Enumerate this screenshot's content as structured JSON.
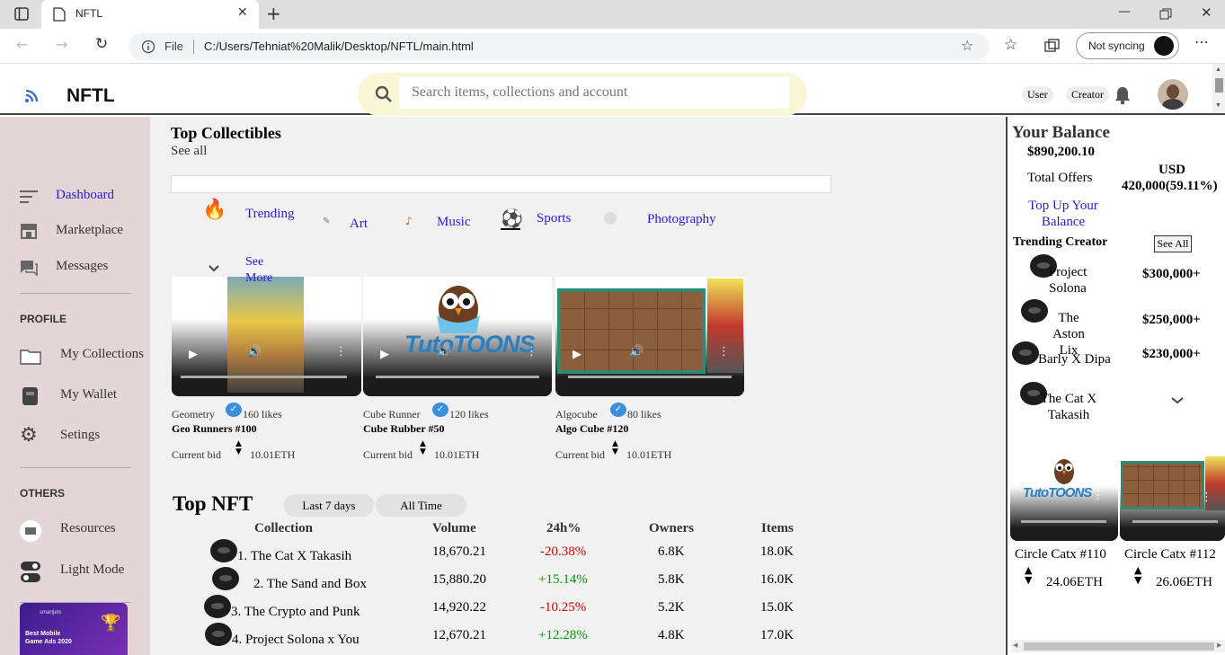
{
  "browser": {
    "tab_title": "NFTL",
    "file_label": "File",
    "url": "C:/Users/Tehniat%20Malik/Desktop/NFTL/main.html",
    "sync_label": "Not syncing"
  },
  "header": {
    "brand": "NFTL",
    "search_placeholder": "Search items, collections and account",
    "user_label": "User",
    "creator_label": "Creator"
  },
  "sidebar": {
    "nav": [
      {
        "label": "Dashboard",
        "icon": "menu-lines-icon",
        "active": true
      },
      {
        "label": "Marketplace",
        "icon": "store-icon"
      },
      {
        "label": "Messages",
        "icon": "chat-icon"
      }
    ],
    "profile_heading": "PROFILE",
    "profile": [
      {
        "label": "My Collections",
        "icon": "folder-icon"
      },
      {
        "label": "My Wallet",
        "icon": "wallet-icon"
      },
      {
        "label": "Setings",
        "icon": "gear-icon"
      }
    ],
    "others_heading": "OTHERS",
    "others": [
      {
        "label": "Resources",
        "icon": "book-icon"
      },
      {
        "label": "Light Mode",
        "icon": "toggle-icon"
      }
    ],
    "ad": {
      "brand": "smartjets",
      "text": "Best Mobile Game Ads 2020"
    }
  },
  "top_collectibles": {
    "title": "Top Collectibles",
    "see_all": "See all",
    "categories": [
      "Trending",
      "Art",
      "Music",
      "Sports",
      "Photography"
    ],
    "see_more": "See More",
    "cards": [
      {
        "creator": "Geometry",
        "likes": "160 likes",
        "name": "Geo Runners #100",
        "bid_label": "Current bid",
        "bid": "10.01ETH"
      },
      {
        "creator": "Cube Runner",
        "likes": "120 likes",
        "name": "Cube Rubber #50",
        "bid_label": "Current bid",
        "bid": "10.01ETH",
        "video_text": "TutoTOONS"
      },
      {
        "creator": "Algocube",
        "likes": "80 likes",
        "name": "Algo Cube #120",
        "bid_label": "Current bid",
        "bid": "10.01ETH"
      }
    ]
  },
  "top_nft": {
    "title": "Top NFT",
    "filters": [
      "Last 7 days",
      "All Time"
    ],
    "columns": [
      "Collection",
      "Volume",
      "24h%",
      "Owners",
      "Items"
    ],
    "rows": [
      {
        "collection": "1. The Cat X Takasih",
        "volume": "18,670.21",
        "change": "-20.38%",
        "owners": "6.8K",
        "items": "18.0K",
        "trend": "down"
      },
      {
        "collection": "2. The Sand and Box",
        "volume": "15,880.20",
        "change": "+15.14%",
        "owners": "5.8K",
        "items": "16.0K",
        "trend": "up"
      },
      {
        "collection": "3. The Crypto and Punk",
        "volume": "14,920.22",
        "change": "-10.25%",
        "owners": "5.2K",
        "items": "15.0K",
        "trend": "down"
      },
      {
        "collection": "4. Project Solona x You",
        "volume": "12,670.21",
        "change": "+12.28%",
        "owners": "4.8K",
        "items": "17.0K",
        "trend": "up"
      }
    ]
  },
  "balance": {
    "title": "Your Balance",
    "amount": "$890,200.10",
    "offers_label": "Total Offers",
    "offers_currency": "USD",
    "offers_value": "420,000(59.11%)",
    "topup": "Top Up Your Balance",
    "trending_label": "Trending Creator",
    "see_all": "See All",
    "creators": [
      {
        "name": "Project Solona",
        "amount": "$300,000+"
      },
      {
        "name": "The Aston Lix",
        "amount": "$250,000+"
      },
      {
        "name": "Barly X Dipa",
        "amount": "$230,000+"
      },
      {
        "name": "The Cat X Takasih",
        "amount": ""
      }
    ],
    "cards": [
      {
        "name": "Circle Catx #110",
        "price": "24.06ETH",
        "video_text": "TutoTOONS"
      },
      {
        "name": "Circle Catx #112",
        "price": "26.06ETH"
      }
    ]
  },
  "colors": {
    "sidebar_bg": "#e4d6d8",
    "link": "#2a1bd1",
    "negative": "#d10000",
    "positive": "#009a00"
  }
}
